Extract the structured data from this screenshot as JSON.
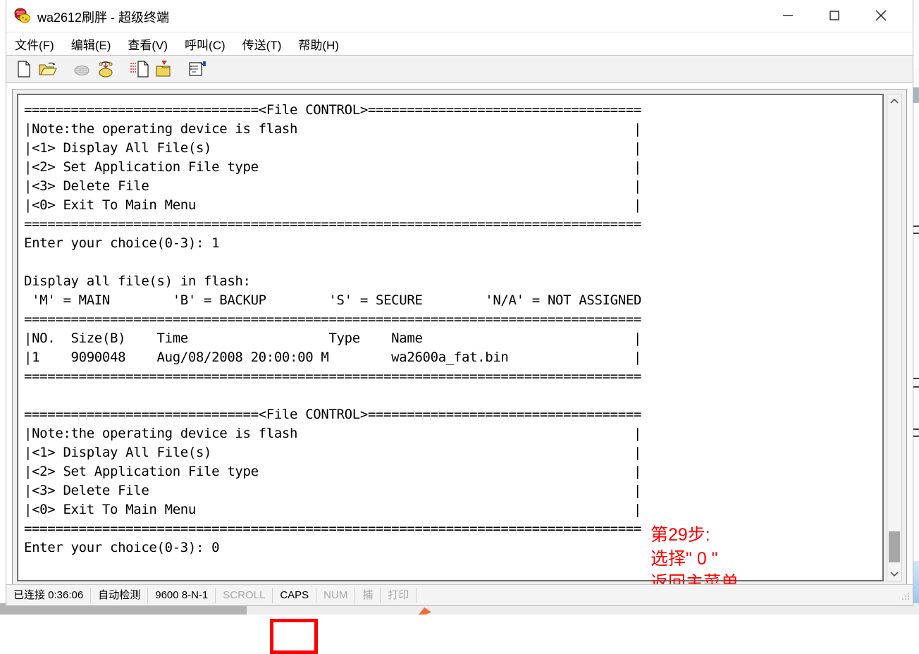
{
  "window": {
    "title": "wa2612刷胖 - 超级终端",
    "icon": "hyperterminal-icon",
    "controls": {
      "minimize": "—",
      "maximize": "□",
      "close": "✕"
    }
  },
  "menubar": {
    "items": [
      {
        "label": "文件(F)",
        "name": "menu-file"
      },
      {
        "label": "编辑(E)",
        "name": "menu-edit"
      },
      {
        "label": "查看(V)",
        "name": "menu-view"
      },
      {
        "label": "呼叫(C)",
        "name": "menu-call"
      },
      {
        "label": "传送(T)",
        "name": "menu-transfer"
      },
      {
        "label": "帮助(H)",
        "name": "menu-help"
      }
    ]
  },
  "toolbar": {
    "buttons": [
      {
        "name": "new-connection-icon",
        "title": "新建连接"
      },
      {
        "name": "open-folder-icon",
        "title": "打开"
      },
      {
        "name": "disconnect-phone-icon",
        "title": "断开",
        "disabled": true
      },
      {
        "name": "connect-phone-icon",
        "title": "呼叫"
      },
      {
        "name": "send-file-icon",
        "title": "发送"
      },
      {
        "name": "receive-file-icon",
        "title": "接收"
      },
      {
        "name": "properties-icon",
        "title": "属性"
      }
    ]
  },
  "terminal": {
    "lines": [
      "==============================<File CONTROL>===================================",
      "|Note:the operating device is flash                                           |",
      "|<1> Display All File(s)                                                      |",
      "|<2> Set Application File type                                                |",
      "|<3> Delete File                                                              |",
      "|<0> Exit To Main Menu                                                        |",
      "===============================================================================",
      "Enter your choice(0-3): 1",
      "",
      "Display all file(s) in flash:",
      " 'M' = MAIN        'B' = BACKUP        'S' = SECURE        'N/A' = NOT ASSIGNED",
      "===============================================================================",
      "|NO.  Size(B)    Time                  Type    Name                           |",
      "|1    9090048    Aug/08/2008 20:00:00 M        wa2600a_fat.bin                |",
      "===============================================================================",
      "",
      "==============================<File CONTROL>===================================",
      "|Note:the operating device is flash                                           |",
      "|<1> Display All File(s)                                                      |",
      "|<2> Set Application File type                                                |",
      "|<3> Delete File                                                              |",
      "|<0> Exit To Main Menu                                                        |",
      "===============================================================================",
      "Enter your choice(0-3): 0"
    ],
    "file_table": {
      "headers": [
        "NO.",
        "Size(B)",
        "Time",
        "Type",
        "Name"
      ],
      "rows": [
        [
          "1",
          "9090048",
          "Aug/08/2008 20:00:00",
          "M",
          "wa2600a_fat.bin"
        ]
      ]
    },
    "menu_title": "<File CONTROL>",
    "note": "Note:the operating device is flash",
    "options": [
      "<1> Display All File(s)",
      "<2> Set Application File type",
      "<3> Delete File",
      "<0> Exit To Main Menu"
    ],
    "prompt": "Enter your choice(0-3):",
    "first_choice": "1",
    "second_choice": "0",
    "legend": "'M' = MAIN        'B' = BACKUP        'S' = SECURE        'N/A' = NOT ASSIGNED",
    "display_header": "Display all file(s) in flash:"
  },
  "annotation": {
    "line1": "第29步:",
    "line2": "选择\" 0 \"",
    "line3": "返回主菜单",
    "color": "#ff0000"
  },
  "statusbar": {
    "connection": "已连接 0:36:06",
    "detect": "自动检测",
    "serial": "9600 8-N-1",
    "scroll": "SCROLL",
    "caps": "CAPS",
    "num": "NUM",
    "capture": "捕",
    "print": "打印"
  },
  "scrollbar": {
    "up_arrow": "︿",
    "down_arrow": "﹀"
  }
}
